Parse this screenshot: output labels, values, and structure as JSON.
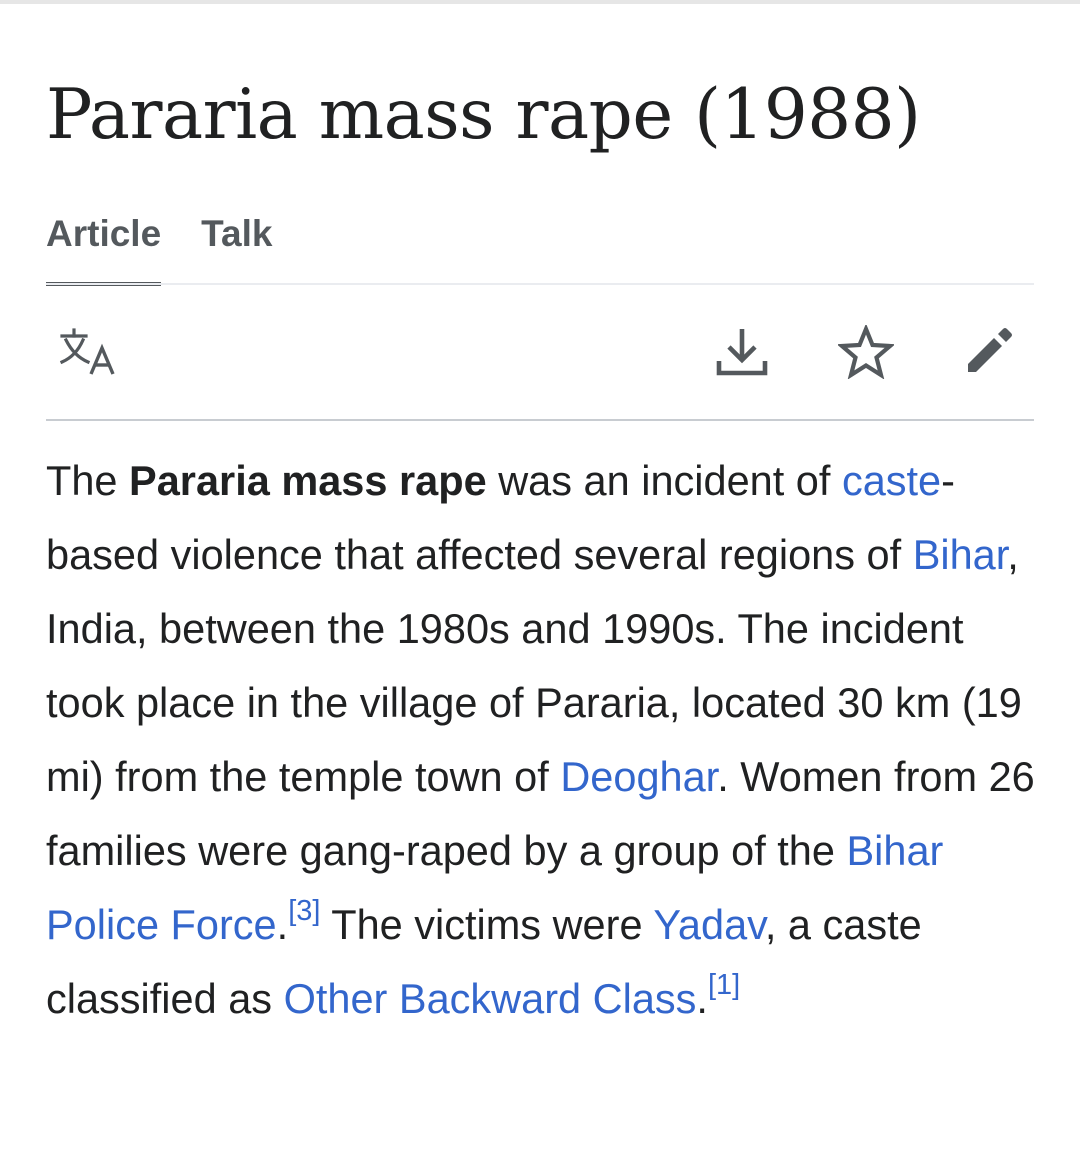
{
  "page": {
    "title": "Pararia mass rape (1988)"
  },
  "tabs": [
    {
      "label": "Article",
      "active": true
    },
    {
      "label": "Talk",
      "active": false
    }
  ],
  "toolbar": {
    "icons": [
      "language-icon",
      "download-icon",
      "star-icon",
      "edit-pencil-icon"
    ]
  },
  "colors": {
    "link": "#3366cc",
    "text": "#202122",
    "tab": "#54595d"
  },
  "article": {
    "s1_t1": "The ",
    "s1_bold": "Pararia mass rape",
    "s1_t2": " was an incident of ",
    "s1_link_caste": "caste",
    "s1_t3": "-based violence that affected several regions of ",
    "s1_link_bihar": "Bihar",
    "s1_t4": ", India, between the 1980s and 1990s. The incident took place in the village of Pararia, located 30 km (19 mi) from the temple town of ",
    "s1_link_deoghar": "Deoghar",
    "s1_t5": ". Women from 26 families were gang-raped by a group of the ",
    "s1_link_police": "Bihar Police Force",
    "s1_t6": ".",
    "s1_ref": "[3]",
    "s2_t1": " The victims were ",
    "s2_link_yadav": "Yadav",
    "s2_t2": ", a caste classified as ",
    "s2_link_obc": "Other Backward Class",
    "s2_t3": ".",
    "s2_ref": "[1]"
  }
}
